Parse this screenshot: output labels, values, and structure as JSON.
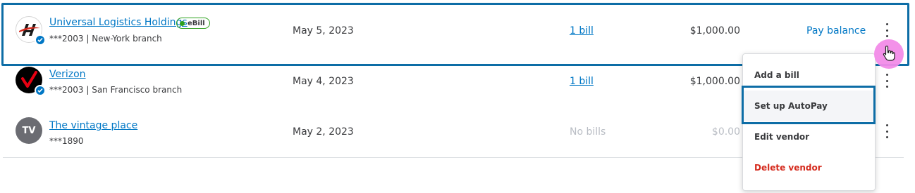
{
  "vendors": [
    {
      "name": "Universal Logistics Holdings",
      "sub": "***2003 | New-York branch",
      "ebill_label": "eBill",
      "date": "May 5, 2023",
      "bills": "1 bill",
      "amount": "$1,000.00",
      "action": "Pay balance"
    },
    {
      "name": "Verizon",
      "sub": "***2003 | San Francisco branch",
      "date": "May 4, 2023",
      "bills": "1 bill",
      "amount": "$1,000.00"
    },
    {
      "name": "The vintage place",
      "initials": "TV",
      "sub": "***1890",
      "date": "May 2, 2023",
      "bills": "No bills",
      "amount": "$0.00"
    }
  ],
  "menu": {
    "items": [
      "Add a bill",
      "Set up AutoPay",
      "Edit vendor",
      "Delete vendor"
    ]
  },
  "colors": {
    "link": "#0077c5",
    "ebill_green": "#2ca01c",
    "danger": "#d52b1e",
    "highlight": "#0d6da6",
    "cursor": "#f28be8"
  },
  "icons": {
    "verified": "check-badge-icon",
    "more": "kebab-menu-icon",
    "cursor": "hand-pointer-icon"
  }
}
